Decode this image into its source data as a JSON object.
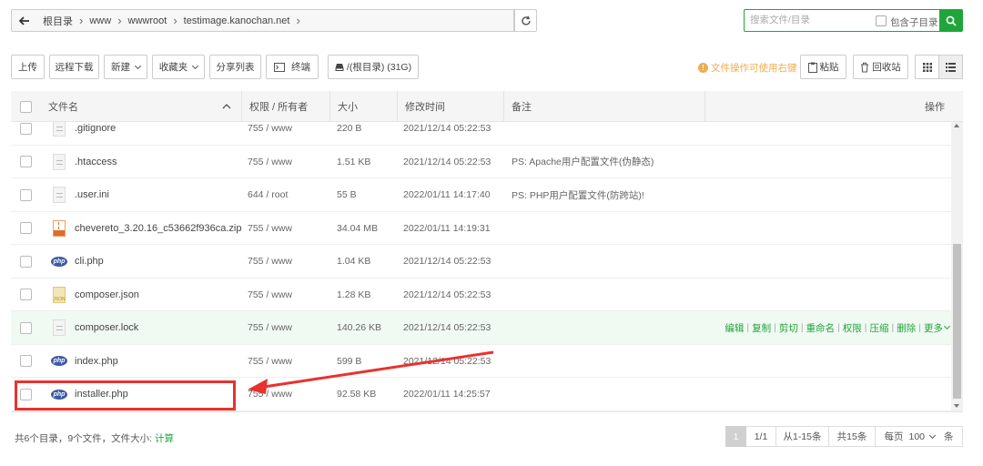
{
  "breadcrumb": [
    "根目录",
    "www",
    "wwwroot",
    "testimage.kanochan.net"
  ],
  "search": {
    "placeholder": "搜索文件/目录",
    "subdir_label": "包含子目录"
  },
  "toolbar": {
    "upload": "上传",
    "remote_download": "远程下载",
    "new": "新建",
    "favorites": "收藏夹",
    "share_list": "分享列表",
    "terminal": "终端",
    "disk": "/(根目录) (31G)",
    "warning": "文件操作可使用右键",
    "paste": "粘贴",
    "recycle_bin": "回收站"
  },
  "table": {
    "headers": {
      "name": "文件名",
      "perm": "权限 / 所有者",
      "size": "大小",
      "mtime": "修改时间",
      "remark": "备注",
      "ops": "操作"
    },
    "rows": [
      {
        "icon": "doc",
        "name": ".gitignore",
        "perm": "755 / www",
        "size": "220 B",
        "mtime": "2021/12/14 05:22:53",
        "remark": ""
      },
      {
        "icon": "doc",
        "name": ".htaccess",
        "perm": "755 / www",
        "size": "1.51 KB",
        "mtime": "2021/12/14 05:22:53",
        "remark": "PS: Apache用户配置文件(伪静态)"
      },
      {
        "icon": "doc",
        "name": ".user.ini",
        "perm": "644 / root",
        "size": "55 B",
        "mtime": "2022/01/11 14:17:40",
        "remark": "PS: PHP用户配置文件(防跨站)!"
      },
      {
        "icon": "zip",
        "name": "chevereto_3.20.16_c53662f936ca.zip",
        "perm": "755 / www",
        "size": "34.04 MB",
        "mtime": "2022/01/11 14:19:31",
        "remark": ""
      },
      {
        "icon": "php",
        "name": "cli.php",
        "perm": "755 / www",
        "size": "1.04 KB",
        "mtime": "2021/12/14 05:22:53",
        "remark": ""
      },
      {
        "icon": "json",
        "name": "composer.json",
        "perm": "755 / www",
        "size": "1.28 KB",
        "mtime": "2021/12/14 05:22:53",
        "remark": ""
      },
      {
        "icon": "doc",
        "name": "composer.lock",
        "perm": "755 / www",
        "size": "140.26 KB",
        "mtime": "2021/12/14 05:22:53",
        "remark": ""
      },
      {
        "icon": "php",
        "name": "index.php",
        "perm": "755 / www",
        "size": "599 B",
        "mtime": "2021/12/14 05:22:53",
        "remark": ""
      },
      {
        "icon": "php",
        "name": "installer.php",
        "perm": "755 / www",
        "size": "92.58 KB",
        "mtime": "2022/01/11 14:25:57",
        "remark": ""
      }
    ],
    "hover_ops": [
      "编辑",
      "复制",
      "剪切",
      "重命名",
      "权限",
      "压缩",
      "删除",
      "更多"
    ]
  },
  "footer": {
    "summary": "共6个目录，9个文件，文件大小:",
    "calc": "计算",
    "page_current": "1",
    "page_of": "1/1",
    "range": "从1-15条",
    "total": "共15条",
    "per_page_label": "每页",
    "per_page_value": "100",
    "unit": "条"
  },
  "colors": {
    "accent": "#20a53a",
    "warning": "#f0ad4e",
    "annotation": "#e8322e"
  }
}
